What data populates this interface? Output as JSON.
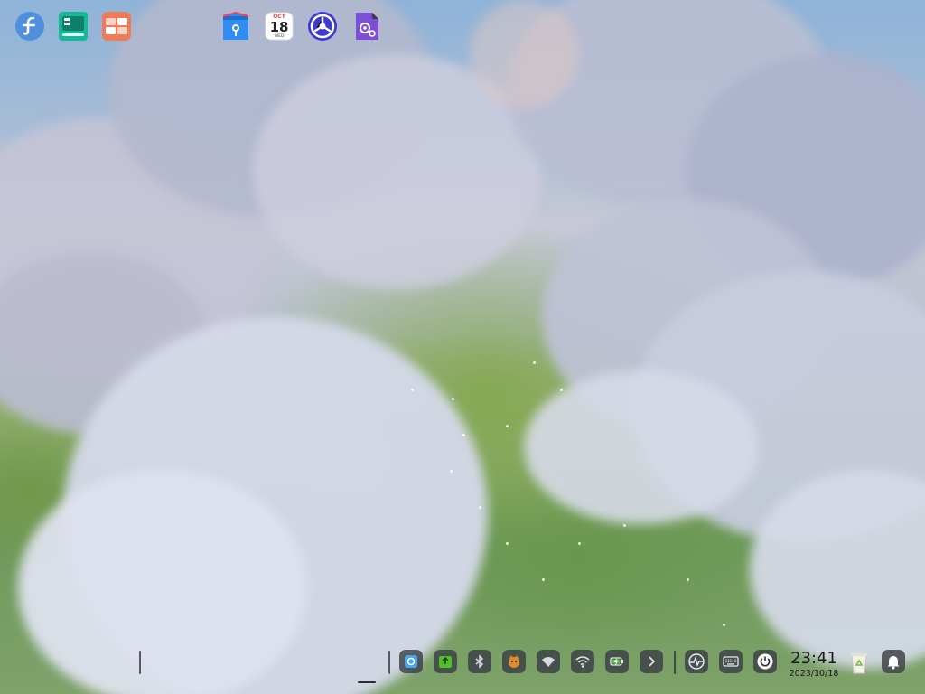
{
  "dock": {
    "left_apps": [
      {
        "name": "launcher",
        "icon": "deepin-launcher-icon",
        "color": "#4f8fdc"
      },
      {
        "name": "multitask-view",
        "icon": "multitask-view-icon",
        "color": "#17b897"
      },
      {
        "name": "workspace",
        "icon": "workspace-icon",
        "color": "#f07b57"
      }
    ],
    "center_apps": [
      {
        "name": "file-manager",
        "icon": "file-manager-icon",
        "color": "#2f8cf0"
      },
      {
        "name": "calendar",
        "icon": "calendar-icon",
        "month": "OCT",
        "day": "18",
        "weekday": "WED"
      },
      {
        "name": "app-store",
        "icon": "app-store-icon",
        "color": "#3d3ad0"
      },
      {
        "name": "control-center",
        "icon": "control-center-icon",
        "color": "#7c4fd6",
        "active": true
      }
    ],
    "tray": [
      {
        "name": "screen-capture",
        "icon": "screenshot-icon",
        "accent": "#49a6e8"
      },
      {
        "name": "app-notification",
        "icon": "app-tray-icon",
        "accent": "#4fbf2a"
      },
      {
        "name": "bluetooth",
        "icon": "bluetooth-icon"
      },
      {
        "name": "app-tray-2",
        "icon": "cat-icon",
        "accent": "#e08a2a"
      },
      {
        "name": "network",
        "icon": "wired-network-icon"
      },
      {
        "name": "wifi",
        "icon": "wifi-icon"
      },
      {
        "name": "battery",
        "icon": "battery-charging-icon",
        "accent": "#57c43a"
      },
      {
        "name": "tray-expand",
        "icon": "chevron-right-icon"
      }
    ],
    "system": [
      {
        "name": "system-monitor",
        "icon": "system-monitor-icon"
      },
      {
        "name": "onboard-keyboard",
        "icon": "keyboard-icon"
      },
      {
        "name": "shutdown",
        "icon": "power-icon"
      }
    ],
    "clock": {
      "time": "23:41",
      "date": "2023/10/18"
    },
    "trash": {
      "icon": "trash-icon",
      "accent": "#7fba3a"
    },
    "notification": {
      "icon": "bell-icon"
    }
  }
}
